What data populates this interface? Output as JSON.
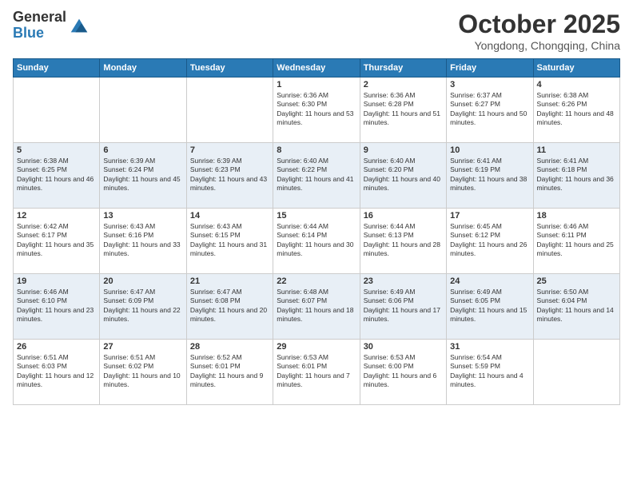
{
  "logo": {
    "general": "General",
    "blue": "Blue"
  },
  "header": {
    "month": "October 2025",
    "location": "Yongdong, Chongqing, China"
  },
  "weekdays": [
    "Sunday",
    "Monday",
    "Tuesday",
    "Wednesday",
    "Thursday",
    "Friday",
    "Saturday"
  ],
  "weeks": [
    [
      {
        "day": "",
        "info": ""
      },
      {
        "day": "",
        "info": ""
      },
      {
        "day": "",
        "info": ""
      },
      {
        "day": "1",
        "info": "Sunrise: 6:36 AM\nSunset: 6:30 PM\nDaylight: 11 hours and 53 minutes."
      },
      {
        "day": "2",
        "info": "Sunrise: 6:36 AM\nSunset: 6:28 PM\nDaylight: 11 hours and 51 minutes."
      },
      {
        "day": "3",
        "info": "Sunrise: 6:37 AM\nSunset: 6:27 PM\nDaylight: 11 hours and 50 minutes."
      },
      {
        "day": "4",
        "info": "Sunrise: 6:38 AM\nSunset: 6:26 PM\nDaylight: 11 hours and 48 minutes."
      }
    ],
    [
      {
        "day": "5",
        "info": "Sunrise: 6:38 AM\nSunset: 6:25 PM\nDaylight: 11 hours and 46 minutes."
      },
      {
        "day": "6",
        "info": "Sunrise: 6:39 AM\nSunset: 6:24 PM\nDaylight: 11 hours and 45 minutes."
      },
      {
        "day": "7",
        "info": "Sunrise: 6:39 AM\nSunset: 6:23 PM\nDaylight: 11 hours and 43 minutes."
      },
      {
        "day": "8",
        "info": "Sunrise: 6:40 AM\nSunset: 6:22 PM\nDaylight: 11 hours and 41 minutes."
      },
      {
        "day": "9",
        "info": "Sunrise: 6:40 AM\nSunset: 6:20 PM\nDaylight: 11 hours and 40 minutes."
      },
      {
        "day": "10",
        "info": "Sunrise: 6:41 AM\nSunset: 6:19 PM\nDaylight: 11 hours and 38 minutes."
      },
      {
        "day": "11",
        "info": "Sunrise: 6:41 AM\nSunset: 6:18 PM\nDaylight: 11 hours and 36 minutes."
      }
    ],
    [
      {
        "day": "12",
        "info": "Sunrise: 6:42 AM\nSunset: 6:17 PM\nDaylight: 11 hours and 35 minutes."
      },
      {
        "day": "13",
        "info": "Sunrise: 6:43 AM\nSunset: 6:16 PM\nDaylight: 11 hours and 33 minutes."
      },
      {
        "day": "14",
        "info": "Sunrise: 6:43 AM\nSunset: 6:15 PM\nDaylight: 11 hours and 31 minutes."
      },
      {
        "day": "15",
        "info": "Sunrise: 6:44 AM\nSunset: 6:14 PM\nDaylight: 11 hours and 30 minutes."
      },
      {
        "day": "16",
        "info": "Sunrise: 6:44 AM\nSunset: 6:13 PM\nDaylight: 11 hours and 28 minutes."
      },
      {
        "day": "17",
        "info": "Sunrise: 6:45 AM\nSunset: 6:12 PM\nDaylight: 11 hours and 26 minutes."
      },
      {
        "day": "18",
        "info": "Sunrise: 6:46 AM\nSunset: 6:11 PM\nDaylight: 11 hours and 25 minutes."
      }
    ],
    [
      {
        "day": "19",
        "info": "Sunrise: 6:46 AM\nSunset: 6:10 PM\nDaylight: 11 hours and 23 minutes."
      },
      {
        "day": "20",
        "info": "Sunrise: 6:47 AM\nSunset: 6:09 PM\nDaylight: 11 hours and 22 minutes."
      },
      {
        "day": "21",
        "info": "Sunrise: 6:47 AM\nSunset: 6:08 PM\nDaylight: 11 hours and 20 minutes."
      },
      {
        "day": "22",
        "info": "Sunrise: 6:48 AM\nSunset: 6:07 PM\nDaylight: 11 hours and 18 minutes."
      },
      {
        "day": "23",
        "info": "Sunrise: 6:49 AM\nSunset: 6:06 PM\nDaylight: 11 hours and 17 minutes."
      },
      {
        "day": "24",
        "info": "Sunrise: 6:49 AM\nSunset: 6:05 PM\nDaylight: 11 hours and 15 minutes."
      },
      {
        "day": "25",
        "info": "Sunrise: 6:50 AM\nSunset: 6:04 PM\nDaylight: 11 hours and 14 minutes."
      }
    ],
    [
      {
        "day": "26",
        "info": "Sunrise: 6:51 AM\nSunset: 6:03 PM\nDaylight: 11 hours and 12 minutes."
      },
      {
        "day": "27",
        "info": "Sunrise: 6:51 AM\nSunset: 6:02 PM\nDaylight: 11 hours and 10 minutes."
      },
      {
        "day": "28",
        "info": "Sunrise: 6:52 AM\nSunset: 6:01 PM\nDaylight: 11 hours and 9 minutes."
      },
      {
        "day": "29",
        "info": "Sunrise: 6:53 AM\nSunset: 6:01 PM\nDaylight: 11 hours and 7 minutes."
      },
      {
        "day": "30",
        "info": "Sunrise: 6:53 AM\nSunset: 6:00 PM\nDaylight: 11 hours and 6 minutes."
      },
      {
        "day": "31",
        "info": "Sunrise: 6:54 AM\nSunset: 5:59 PM\nDaylight: 11 hours and 4 minutes."
      },
      {
        "day": "",
        "info": ""
      }
    ]
  ]
}
